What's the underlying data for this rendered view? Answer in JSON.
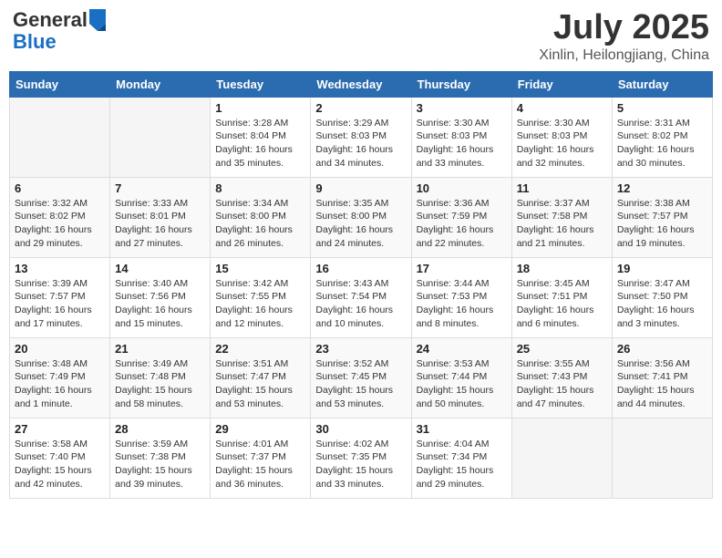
{
  "header": {
    "logo_general": "General",
    "logo_blue": "Blue",
    "title": "July 2025",
    "location": "Xinlin, Heilongjiang, China"
  },
  "days_of_week": [
    "Sunday",
    "Monday",
    "Tuesday",
    "Wednesday",
    "Thursday",
    "Friday",
    "Saturday"
  ],
  "weeks": [
    [
      {
        "day": "",
        "info": ""
      },
      {
        "day": "",
        "info": ""
      },
      {
        "day": "1",
        "info": "Sunrise: 3:28 AM\nSunset: 8:04 PM\nDaylight: 16 hours and 35 minutes."
      },
      {
        "day": "2",
        "info": "Sunrise: 3:29 AM\nSunset: 8:03 PM\nDaylight: 16 hours and 34 minutes."
      },
      {
        "day": "3",
        "info": "Sunrise: 3:30 AM\nSunset: 8:03 PM\nDaylight: 16 hours and 33 minutes."
      },
      {
        "day": "4",
        "info": "Sunrise: 3:30 AM\nSunset: 8:03 PM\nDaylight: 16 hours and 32 minutes."
      },
      {
        "day": "5",
        "info": "Sunrise: 3:31 AM\nSunset: 8:02 PM\nDaylight: 16 hours and 30 minutes."
      }
    ],
    [
      {
        "day": "6",
        "info": "Sunrise: 3:32 AM\nSunset: 8:02 PM\nDaylight: 16 hours and 29 minutes."
      },
      {
        "day": "7",
        "info": "Sunrise: 3:33 AM\nSunset: 8:01 PM\nDaylight: 16 hours and 27 minutes."
      },
      {
        "day": "8",
        "info": "Sunrise: 3:34 AM\nSunset: 8:00 PM\nDaylight: 16 hours and 26 minutes."
      },
      {
        "day": "9",
        "info": "Sunrise: 3:35 AM\nSunset: 8:00 PM\nDaylight: 16 hours and 24 minutes."
      },
      {
        "day": "10",
        "info": "Sunrise: 3:36 AM\nSunset: 7:59 PM\nDaylight: 16 hours and 22 minutes."
      },
      {
        "day": "11",
        "info": "Sunrise: 3:37 AM\nSunset: 7:58 PM\nDaylight: 16 hours and 21 minutes."
      },
      {
        "day": "12",
        "info": "Sunrise: 3:38 AM\nSunset: 7:57 PM\nDaylight: 16 hours and 19 minutes."
      }
    ],
    [
      {
        "day": "13",
        "info": "Sunrise: 3:39 AM\nSunset: 7:57 PM\nDaylight: 16 hours and 17 minutes."
      },
      {
        "day": "14",
        "info": "Sunrise: 3:40 AM\nSunset: 7:56 PM\nDaylight: 16 hours and 15 minutes."
      },
      {
        "day": "15",
        "info": "Sunrise: 3:42 AM\nSunset: 7:55 PM\nDaylight: 16 hours and 12 minutes."
      },
      {
        "day": "16",
        "info": "Sunrise: 3:43 AM\nSunset: 7:54 PM\nDaylight: 16 hours and 10 minutes."
      },
      {
        "day": "17",
        "info": "Sunrise: 3:44 AM\nSunset: 7:53 PM\nDaylight: 16 hours and 8 minutes."
      },
      {
        "day": "18",
        "info": "Sunrise: 3:45 AM\nSunset: 7:51 PM\nDaylight: 16 hours and 6 minutes."
      },
      {
        "day": "19",
        "info": "Sunrise: 3:47 AM\nSunset: 7:50 PM\nDaylight: 16 hours and 3 minutes."
      }
    ],
    [
      {
        "day": "20",
        "info": "Sunrise: 3:48 AM\nSunset: 7:49 PM\nDaylight: 16 hours and 1 minute."
      },
      {
        "day": "21",
        "info": "Sunrise: 3:49 AM\nSunset: 7:48 PM\nDaylight: 15 hours and 58 minutes."
      },
      {
        "day": "22",
        "info": "Sunrise: 3:51 AM\nSunset: 7:47 PM\nDaylight: 15 hours and 53 minutes."
      },
      {
        "day": "23",
        "info": "Sunrise: 3:52 AM\nSunset: 7:45 PM\nDaylight: 15 hours and 53 minutes."
      },
      {
        "day": "24",
        "info": "Sunrise: 3:53 AM\nSunset: 7:44 PM\nDaylight: 15 hours and 50 minutes."
      },
      {
        "day": "25",
        "info": "Sunrise: 3:55 AM\nSunset: 7:43 PM\nDaylight: 15 hours and 47 minutes."
      },
      {
        "day": "26",
        "info": "Sunrise: 3:56 AM\nSunset: 7:41 PM\nDaylight: 15 hours and 44 minutes."
      }
    ],
    [
      {
        "day": "27",
        "info": "Sunrise: 3:58 AM\nSunset: 7:40 PM\nDaylight: 15 hours and 42 minutes."
      },
      {
        "day": "28",
        "info": "Sunrise: 3:59 AM\nSunset: 7:38 PM\nDaylight: 15 hours and 39 minutes."
      },
      {
        "day": "29",
        "info": "Sunrise: 4:01 AM\nSunset: 7:37 PM\nDaylight: 15 hours and 36 minutes."
      },
      {
        "day": "30",
        "info": "Sunrise: 4:02 AM\nSunset: 7:35 PM\nDaylight: 15 hours and 33 minutes."
      },
      {
        "day": "31",
        "info": "Sunrise: 4:04 AM\nSunset: 7:34 PM\nDaylight: 15 hours and 29 minutes."
      },
      {
        "day": "",
        "info": ""
      },
      {
        "day": "",
        "info": ""
      }
    ]
  ]
}
